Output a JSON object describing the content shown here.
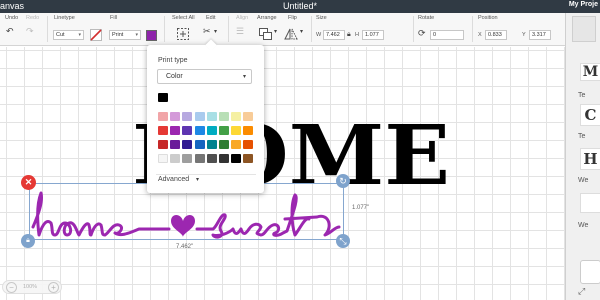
{
  "titlebar": {
    "left": "anvas",
    "title": "Untitled*",
    "right": "My Proje"
  },
  "toolbar": {
    "undo": "Undo",
    "redo": "Redo",
    "linetype": {
      "label": "Linetype",
      "value": "Cut"
    },
    "fill": {
      "label": "Fill",
      "value": "Print",
      "color": "#8e24aa"
    },
    "select_all": "Select All",
    "edit": "Edit",
    "align": "Align",
    "arrange": "Arrange",
    "flip": "Flip",
    "size": {
      "label": "Size",
      "w_label": "W",
      "w": "7.462",
      "h_label": "H",
      "h": "1.077"
    },
    "rotate": {
      "label": "Rotate",
      "value": "0"
    },
    "position": {
      "label": "Position",
      "x_label": "X",
      "x": "0.833",
      "y_label": "Y",
      "y": "3.317"
    }
  },
  "print_type_popup": {
    "label": "Print type",
    "selected": "Color",
    "advanced": "Advanced",
    "swatches": [
      [
        "#f1a5a8",
        "#d49ad9",
        "#b7a9e0",
        "#a9cbee",
        "#a8dfe5",
        "#b8dfb6",
        "#f5f0a2",
        "#f8cc98"
      ],
      [
        "#e53935",
        "#9c27b0",
        "#5e35b1",
        "#1e88e5",
        "#00acc1",
        "#43a047",
        "#fdd835",
        "#fb8c00"
      ],
      [
        "#c62828",
        "#6a1b9a",
        "#311b92",
        "#1565c0",
        "#00838f",
        "#2e7d32",
        "#f9a825",
        "#e65100"
      ],
      [
        "#f5f5f5",
        "#cccccc",
        "#9e9e9e",
        "#757575",
        "#505050",
        "#333333",
        "#000000",
        "#8d5524"
      ]
    ]
  },
  "design": {
    "home_text": "HOME",
    "script_text": "home sweet",
    "width_dim": "7.462\"",
    "height_dim": "1.077\"",
    "script_color": "#9c27b0",
    "black_swatch": "#000000"
  },
  "zoom": {
    "value": "100%"
  },
  "right_panel": {
    "items": [
      "Te",
      "Te",
      "We",
      "We"
    ],
    "glyphs": [
      "M",
      "C",
      "H"
    ]
  }
}
